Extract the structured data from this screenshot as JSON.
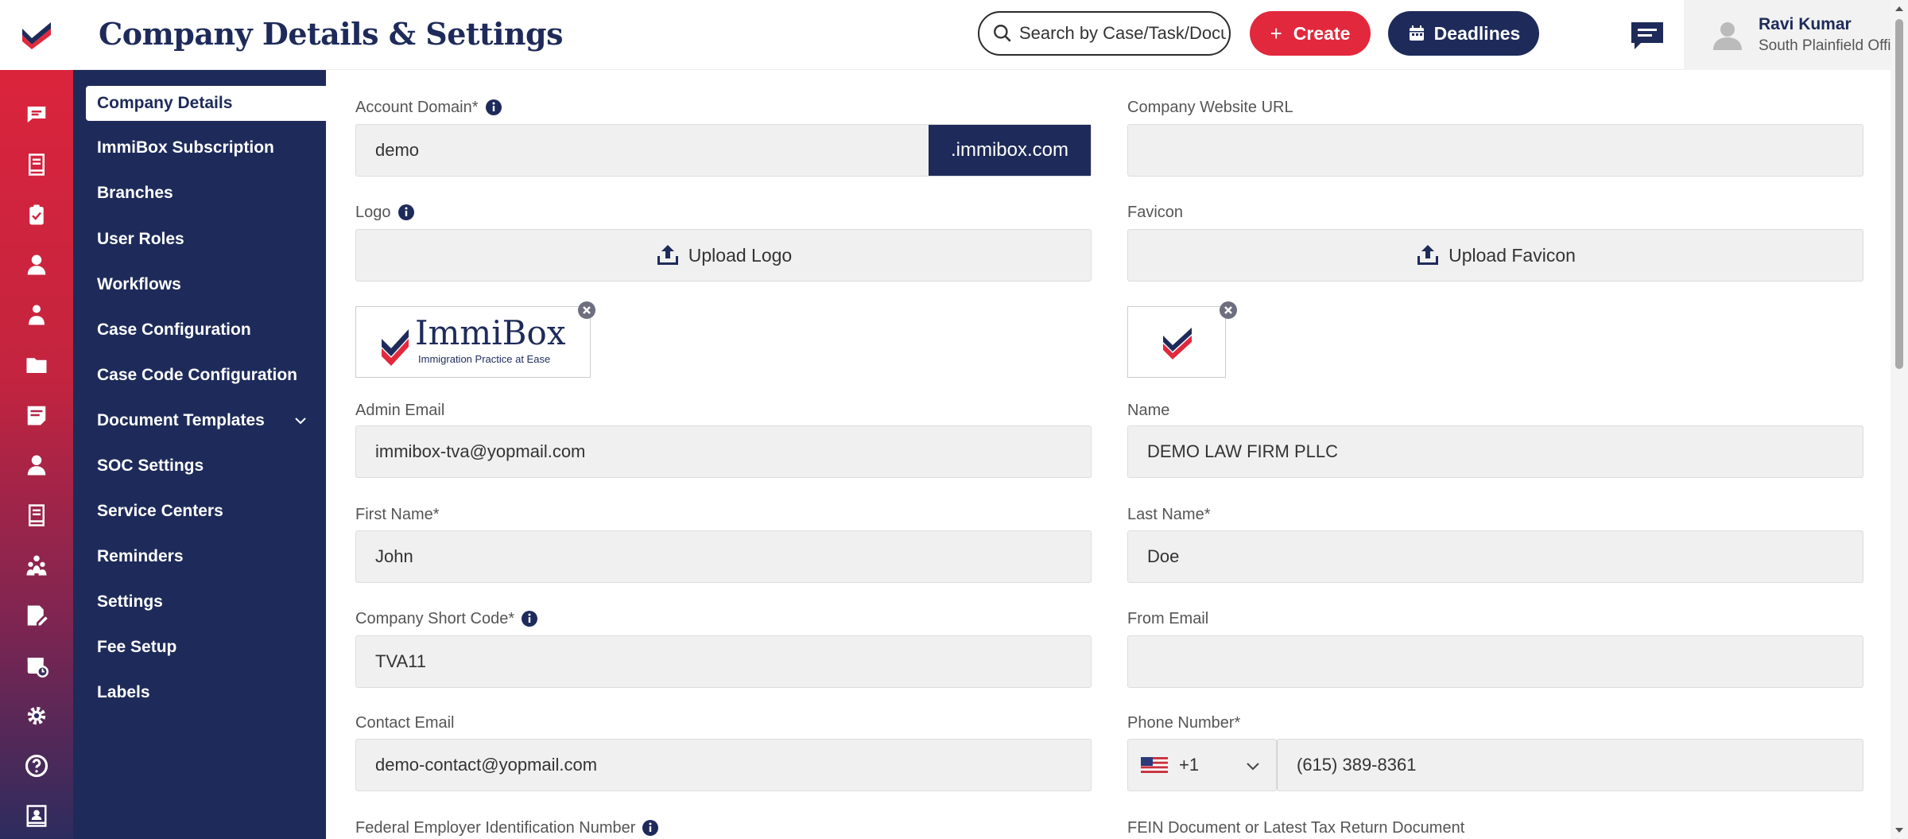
{
  "header": {
    "title": "Company Details & Settings",
    "search_placeholder": "Search by Case/Task/Document",
    "create_label": "Create",
    "deadlines_label": "Deadlines",
    "user_name": "Ravi Kumar",
    "user_office": "South Plainfield Office"
  },
  "rail": {
    "icons": [
      "chat-icon",
      "book-icon",
      "clipboard-icon",
      "user-icon",
      "users-icon",
      "folder-icon",
      "notes-icon",
      "contact-icon",
      "ledger-icon",
      "team-icon",
      "edit-doc-icon",
      "calendar-icon",
      "gear-icon",
      "help-icon",
      "profile-card-icon"
    ]
  },
  "nav": {
    "items": [
      {
        "label": "Company Details",
        "active": true
      },
      {
        "label": "ImmiBox Subscription"
      },
      {
        "label": "Branches"
      },
      {
        "label": "User Roles"
      },
      {
        "label": "Workflows"
      },
      {
        "label": "Case Configuration"
      },
      {
        "label": "Case Code Configuration"
      },
      {
        "label": "Document Templates",
        "has_submenu": true
      },
      {
        "label": "SOC Settings"
      },
      {
        "label": "Service Centers"
      },
      {
        "label": "Reminders"
      },
      {
        "label": "Settings"
      },
      {
        "label": "Fee Setup"
      },
      {
        "label": "Labels"
      }
    ]
  },
  "form": {
    "account_domain": {
      "label": "Account Domain*",
      "value": "demo",
      "suffix": ".immibox.com"
    },
    "company_website": {
      "label": "Company Website URL",
      "value": ""
    },
    "logo": {
      "label": "Logo",
      "upload_label": "Upload Logo",
      "preview_brand": "ImmiBox",
      "preview_tagline": "Immigration Practice at Ease"
    },
    "favicon": {
      "label": "Favicon",
      "upload_label": "Upload Favicon"
    },
    "admin_email": {
      "label": "Admin Email",
      "value": "immibox-tva@yopmail.com"
    },
    "name": {
      "label": "Name",
      "value": "DEMO LAW FIRM PLLC"
    },
    "first_name": {
      "label": "First Name*",
      "value": "John"
    },
    "last_name": {
      "label": "Last Name*",
      "value": "Doe"
    },
    "company_short_code": {
      "label": "Company Short Code*",
      "value": "TVA11"
    },
    "from_email": {
      "label": "From Email",
      "value": ""
    },
    "contact_email": {
      "label": "Contact Email",
      "value": "demo-contact@yopmail.com"
    },
    "phone_number": {
      "label": "Phone Number*",
      "country_code": "+1",
      "value": "(615) 389-8361"
    },
    "fein": {
      "label": "Federal Employer Identification Number"
    },
    "fein_document": {
      "label": "FEIN Document or Latest Tax Return Document"
    }
  },
  "colors": {
    "brand_navy": "#1e2b5a",
    "brand_red": "#e2283c"
  }
}
